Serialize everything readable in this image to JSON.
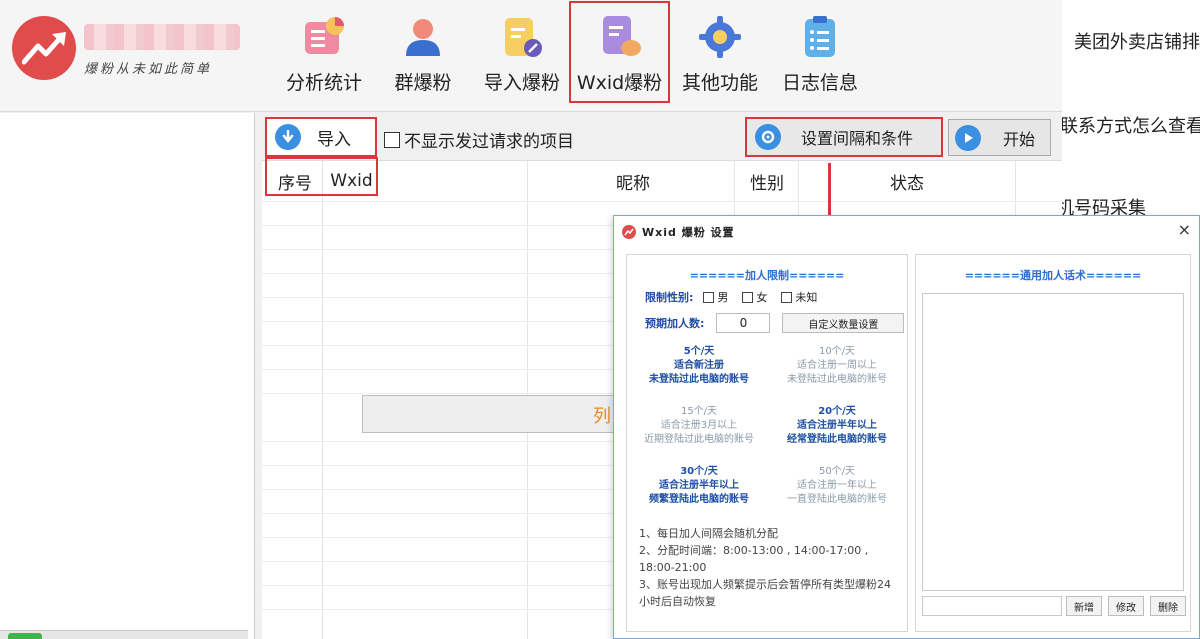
{
  "toolbar": {
    "slogan": "爆粉从未如此简单",
    "buttons": [
      {
        "label": "分析统计",
        "icon": "chart-icon"
      },
      {
        "label": "群爆粉",
        "icon": "user-icon"
      },
      {
        "label": "导入爆粉",
        "icon": "import-file-icon"
      },
      {
        "label": "Wxid爆粉",
        "icon": "wxid-chat-icon",
        "selected": true
      },
      {
        "label": "其他功能",
        "icon": "gear-icon"
      },
      {
        "label": "日志信息",
        "icon": "clipboard-icon"
      }
    ]
  },
  "right_strip": [
    "美团外卖店铺排",
    "联系方式怎么查看",
    "机号码采集"
  ],
  "main": {
    "import_label": "导入",
    "hide_sent_label": "不显示发过请求的项目",
    "settings_label": "设置间隔和条件",
    "start_label": "开始",
    "columns": [
      "序号",
      "Wxid",
      "昵称",
      "性别",
      "状态"
    ],
    "list_overlay_text": "列"
  },
  "dialog": {
    "title": "Wxid 爆粉 设置",
    "close": "×",
    "left_section_title": "======加人限制======",
    "gender_label": "限制性别:",
    "gender_options": [
      "男",
      "女",
      "未知"
    ],
    "expected_label": "预期加人数:",
    "expected_value": "0",
    "custom_button": "自定义数量设置",
    "options": [
      {
        "l1": "5个/天",
        "l2": "适合新注册",
        "l3": "未登陆过此电脑的账号",
        "active": true
      },
      {
        "l1": "10个/天",
        "l2": "适合注册一周以上",
        "l3": "未登陆过此电脑的账号",
        "active": false
      },
      {
        "l1": "15个/天",
        "l2": "适合注册3月以上",
        "l3": "近期登陆过此电脑的账号",
        "active": false
      },
      {
        "l1": "20个/天",
        "l2": "适合注册半年以上",
        "l3": "经常登陆此电脑的账号",
        "active": true
      },
      {
        "l1": "30个/天",
        "l2": "适合注册半年以上",
        "l3": "频繁登陆此电脑的账号",
        "active": true
      },
      {
        "l1": "50个/天",
        "l2": "适合注册一年以上",
        "l3": "一直登陆此电脑的账号",
        "active": false
      }
    ],
    "notes": [
      "1、每日加人间隔会随机分配",
      "2、分配时间端：8:00-13:00 , 14:00-17:00 , 18:00-21:00",
      "3、账号出现加人频繁提示后会暂停所有类型爆粉24小时后自动恢复"
    ],
    "right_section_title": "======通用加人话术======",
    "btn_add": "新增",
    "btn_edit": "修改",
    "btn_delete": "删除"
  },
  "colors": {
    "accent_red": "#d9363e",
    "logo_red": "#e04b4b",
    "link_blue": "#1e4fa3"
  }
}
